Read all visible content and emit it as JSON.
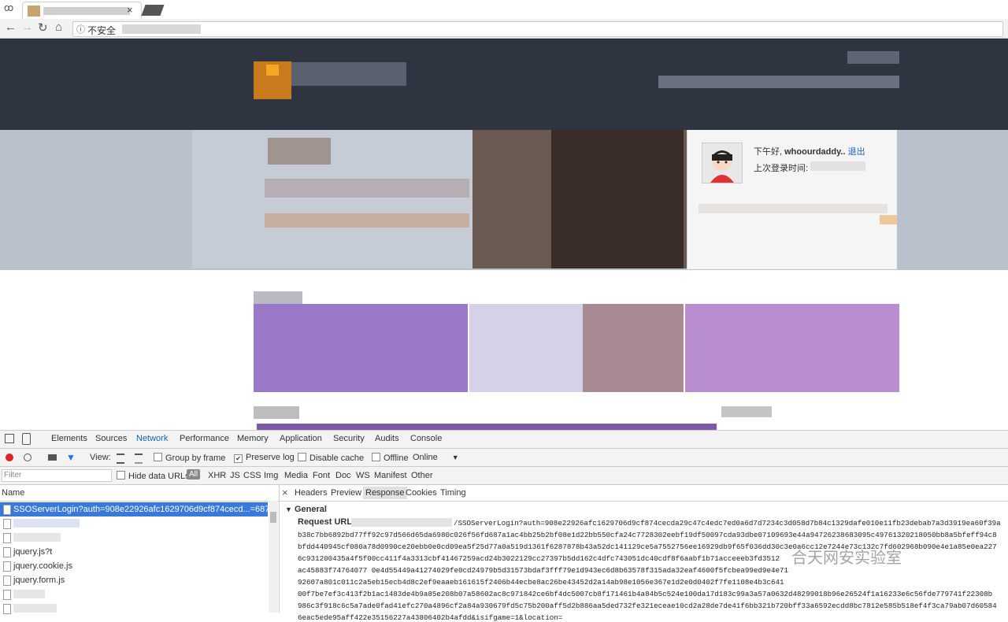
{
  "browser": {
    "tab_close": "×",
    "devmode_icon": "ꝏ",
    "nav": {
      "back": "←",
      "forward": "→",
      "reload": "↻",
      "home": "⌂"
    },
    "info_icon": "ⓘ",
    "insecure_label": "不安全"
  },
  "page": {
    "user_panel": {
      "greeting": "下午好,",
      "username": "whoourdaddy..",
      "logout": "退出",
      "last_login_label": "上次登录时间:"
    }
  },
  "devtools": {
    "tabs": [
      "Elements",
      "Sources",
      "Network",
      "Performance",
      "Memory",
      "Application",
      "Security",
      "Audits",
      "Console"
    ],
    "toolbar": {
      "view_label": "View:",
      "group_by_frame": "Group by frame",
      "preserve_log": "Preserve log",
      "disable_cache": "Disable cache",
      "offline": "Offline",
      "throttle": "Online"
    },
    "filter": {
      "placeholder": "Filter",
      "hide_data_urls": "Hide data URLs",
      "all": "All",
      "types": [
        "XHR",
        "JS",
        "CSS",
        "Img",
        "Media",
        "Font",
        "Doc",
        "WS",
        "Manifest",
        "Other"
      ]
    },
    "requests": {
      "header": "Name",
      "items": [
        "SSOServerLogin?auth=908e22926afc1629706d9cf874cecd...=687474703",
        "",
        "",
        "jquery.js?t",
        "jquery.cookie.js",
        "jquery.form.js",
        "",
        ""
      ]
    },
    "detail": {
      "tabs": [
        "Headers",
        "Preview",
        "Response",
        "Cookies",
        "Timing"
      ],
      "general_label": "General",
      "request_url_label": "Request URL:",
      "request_url_lines": [
        "/SSOServerLogin?auth=908e22926afc1629706d9cf874cecda29c47c4edc7ed0a6d7d7234c3d058d7b84c1329dafe010e11fb23debab7a3d3919ea60f39a",
        "b38c7bb6892bd77ff92c97d566d65da6980c026f56fd687a1ac4bb25b2bf08e1d22bb550cfa24c7728302eebf19df50097cda93dbe07109693e44a94726238683095c49761320218050bb8a5bfeff94c8",
        "bfdd440945cf080a78d0990ce20ebb0e0cd09ea5f25d77a0a519d1361f6287878b43a52dc141129ce5a7552756ee16929db9f65f036dd30c3e0a6cc12e7244e73c132c7fd602968b090e4e1a85e0ea227",
        "6c931200435a4f5f00cc411f4a3313cbf41467259acd24b3022129cc27397b5dd162c4dfc743051dc40cdf8f6aabf1b71acceeeb3fd3512",
        "ac45883f74764077 0e4d55449a41274029fe0cd24979b5d31573bdaf3fff79e1d943ec6d8b63578f315ada32eaf4600f5fcbea99ed9e4e71",
        "92607a801c011c2a5eb15ecb4d8c2ef9eaaeb161615f2406b44ecbe8ac26be43452d2a14ab98e1056e367e1d2e0d0402f7fe1108e4b3c641",
        "00f7be7ef3c413f2b1ac1483de4b9a85e208b07a58602ac8c971842ce6bf4dc5007cb8f171461b4a84b5c524e100da17d183c99a3a57a0632d48299018b96e26524f1a16233e6c56fde779741f22308b",
        "986c3f918c6c5a7ade0fad41efc270a4896cf2a84a930679fd5c75b200aff5d2b886aa5ded732fe321eceae10cd2a28de7de41f6bb321b720bff33a6592ecdd8bc7812e585b518ef4f3ca79ab07d60584",
        "6eac5ede95aff422e35156227a43806402b4afdd&isifgame=1&location="
      ]
    }
  },
  "watermark": "合天网安实验室"
}
